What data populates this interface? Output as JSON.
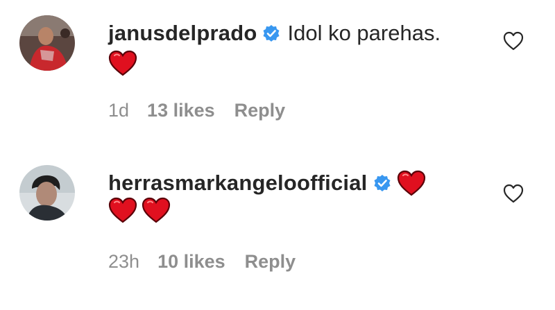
{
  "comments": [
    {
      "username": "janusdelprado",
      "text": "Idol ko parehas.",
      "time": "1d",
      "likes": "13 likes",
      "reply": "Reply",
      "avatar_icon": "avatar-photo",
      "verified_icon": "verified-badge-icon",
      "emoji": [
        "red-heart"
      ]
    },
    {
      "username": "herrasmarkangeloofficial",
      "text": "",
      "time": "23h",
      "likes": "10 likes",
      "reply": "Reply",
      "avatar_icon": "avatar-photo",
      "verified_icon": "verified-badge-icon",
      "emoji": [
        "red-heart",
        "red-heart",
        "red-heart"
      ]
    }
  ],
  "colors": {
    "text": "#262626",
    "secondary": "#8e8e8e",
    "verified": "#3897f0",
    "heart": "#e0101f"
  }
}
